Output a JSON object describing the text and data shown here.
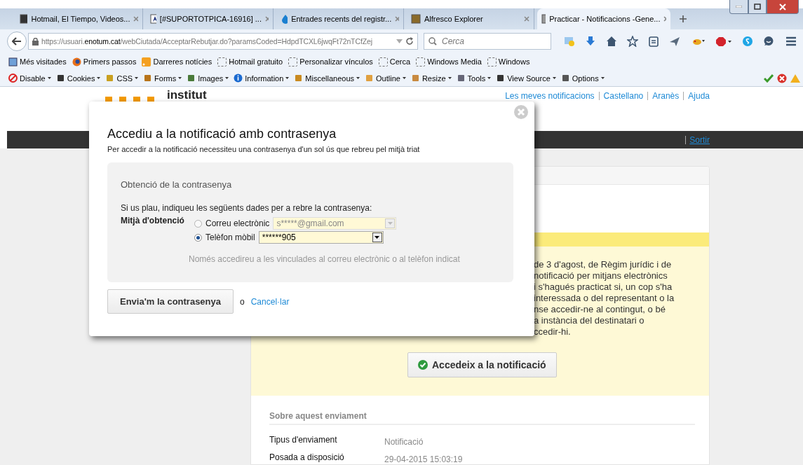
{
  "browser": {
    "tabs": [
      {
        "title": "Hotmail, El Tiempo, Videos...",
        "selected": false
      },
      {
        "title": "[#SUPORTOTPICA-16916] ...",
        "selected": false
      },
      {
        "title": "Entrades recents del registr...",
        "selected": false
      },
      {
        "title": "Alfresco Explorer",
        "selected": false
      },
      {
        "title": "Practicar - Notificacions -Gene...",
        "selected": true
      }
    ],
    "url": "https://usuari.**enotum.cat**/webCiutada/AcceptarRebutjar.do?paramsCoded=HdpdTCXL6jwqFt72nTCfZej",
    "search": {
      "placeholder": "Cerca"
    },
    "bookmarks": [
      "Més visitades",
      "Primers passos",
      "Darreres notícies",
      "Hotmail gratuito",
      "Personalizar vínculos",
      "Cerca",
      "Windows Media",
      "Windows"
    ],
    "dev_toolbar": [
      "Disable",
      "Cookies",
      "CSS",
      "Forms",
      "Images",
      "Information",
      "Miscellaneous",
      "Outline",
      "Resize",
      "Tools",
      "View Source",
      "Options"
    ]
  },
  "page": {
    "logo": "institut",
    "header_links": [
      "Les meves notificacions",
      "Castellano",
      "Aranès",
      "Ajuda"
    ],
    "nav_link": "Sortir",
    "notice_lines": [
      "de 3 d'agost, de Règim jurídic i de",
      "notificació per mitjans electrònics",
      "i s'hagués practicat si, un cop s'ha",
      "interessada o del representant o la",
      "nse accedir-ne al contingut, o bé",
      "a instància del destinatari o",
      "ccedir-hi."
    ],
    "access_button": "Accedeix a la notificació",
    "details": {
      "title": "Sobre aquest enviament",
      "rows": [
        {
          "label": "Tipus d'enviament",
          "value": "Notificació"
        },
        {
          "label": "Posada a disposició",
          "value": "29-04-2015 15:03:19"
        }
      ]
    }
  },
  "dialog": {
    "title": "Accediu a la notificació amb contrasenya",
    "subtitle": "Per accedir a la notificació necessiteu una contrasenya d'un sol ús que rebreu pel mitjà triat",
    "section_title": "Obtenció de la contrasenya",
    "instruction": "Si us plau, indiqueu les següents dades per a rebre la contrasenya:",
    "field_label": "Mitjà d'obtenció",
    "options": [
      {
        "label": "Correu electrònic",
        "value": "s*****@gmail.com",
        "selected": false
      },
      {
        "label": "Telèfon mòbil",
        "value": "******905",
        "selected": true
      }
    ],
    "note": "Només accedireu a les vinculades al correu electrònic o al telèfon indicat",
    "submit": "Envia'm la contrasenya",
    "or": "o",
    "cancel": "Cancel·lar"
  }
}
